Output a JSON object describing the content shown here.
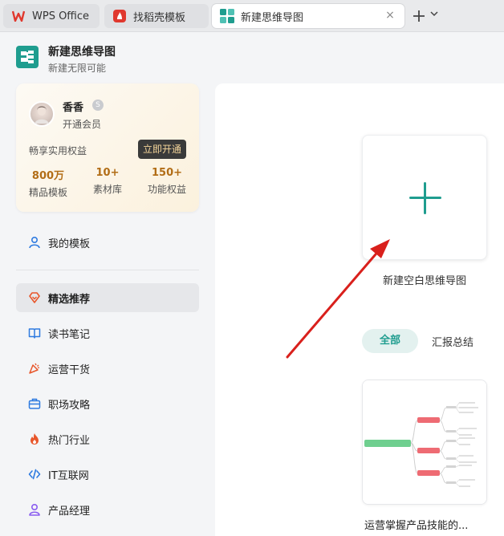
{
  "tabs": [
    {
      "label": "WPS Office",
      "icon": "wps-logo-icon",
      "color": "#e0382e"
    },
    {
      "label": "找稻壳模板",
      "icon": "docer-logo-icon",
      "color": "#e0382e"
    },
    {
      "label": "新建思维导图",
      "icon": "mindmap-logo-icon",
      "color": "#1f9d8f",
      "active": true
    }
  ],
  "tab_close": "×",
  "header": {
    "title": "新建思维导图",
    "subtitle": "新建无限可能"
  },
  "member": {
    "name": "香香",
    "badge": "S",
    "status": "开通会员",
    "benefit_text": "畅享实用权益",
    "open_button": "立即开通",
    "stats": [
      {
        "value": "800万",
        "label": "精品模板"
      },
      {
        "value": "10+",
        "label": "素材库"
      },
      {
        "value": "150+",
        "label": "功能权益"
      }
    ]
  },
  "nav": {
    "my_templates": "我的模板",
    "items": [
      {
        "label": "精选推荐",
        "icon": "heart-diamond-icon",
        "color": "#e8572c",
        "active": true
      },
      {
        "label": "读书笔记",
        "icon": "book-icon",
        "color": "#2f7be0"
      },
      {
        "label": "运营干货",
        "icon": "party-popper-icon",
        "color": "#e8572c"
      },
      {
        "label": "职场攻略",
        "icon": "briefcase-icon",
        "color": "#2f7be0"
      },
      {
        "label": "热门行业",
        "icon": "flame-icon",
        "color": "#e8572c"
      },
      {
        "label": "IT互联网",
        "icon": "code-icon",
        "color": "#2f7be0"
      },
      {
        "label": "产品经理",
        "icon": "user-icon",
        "color": "#8a5cf0"
      }
    ]
  },
  "main": {
    "new_blank_label": "新建空白思维导图",
    "categories": [
      {
        "label": "全部",
        "active": true
      },
      {
        "label": "汇报总结"
      }
    ],
    "templates": [
      {
        "title": "运营掌握产品技能的..."
      }
    ]
  },
  "colors": {
    "accent": "#1f9d8f",
    "annotation_arrow": "#d9201c",
    "gold": "#b26d16"
  }
}
